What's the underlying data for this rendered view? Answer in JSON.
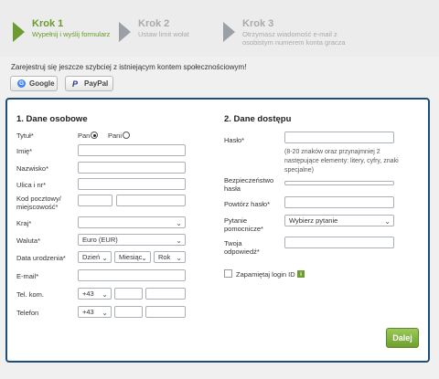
{
  "steps": [
    {
      "title": "Krok 1",
      "desc": "Wypełnij i wyślij formularz"
    },
    {
      "title": "Krok 2",
      "desc": "Ustaw limit wołat"
    },
    {
      "title": "Krok 3",
      "desc": "Otrzymasz wiadomość e-mail z osobistym numerem konta gracza"
    }
  ],
  "social": {
    "text": "Zarejestruj się jeszcze szybciej z istniejącym kontem społecznościowym!",
    "google": "Google",
    "paypal": "PayPal"
  },
  "personal": {
    "heading": "1. Dane osobowe",
    "title_label": "Tytuł*",
    "mr": "Pan",
    "mrs": "Pani",
    "first_name": "Imię*",
    "last_name": "Nazwisko*",
    "street": "Ulica i nr*",
    "postal": "Kod pocztowy/ miejscowość*",
    "country": "Kraj*",
    "currency": "Waluta*",
    "currency_value": "Euro (EUR)",
    "dob": "Data urodzenia*",
    "day": "Dzień",
    "month": "Miesiąc",
    "year": "Rok",
    "email": "E-mail*",
    "mobile": "Tel. kom.",
    "phone": "Telefon",
    "prefix": "+43"
  },
  "access": {
    "heading": "2. Dane dostępu",
    "password": "Hasło*",
    "hint": "(8-20 znaków oraz przynajmniej 2 następujące elementy: litery, cyfry, znaki specjalne)",
    "security": "Bezpieczeństwo hasła",
    "repeat": "Powtórz hasło*",
    "question": "Pytanie pomocnicze*",
    "question_value": "Wybierz pytanie",
    "answer": "Twoja odpowiedź*",
    "remember": "Zapamiętaj login ID",
    "info": "i"
  },
  "next": "Dalej"
}
